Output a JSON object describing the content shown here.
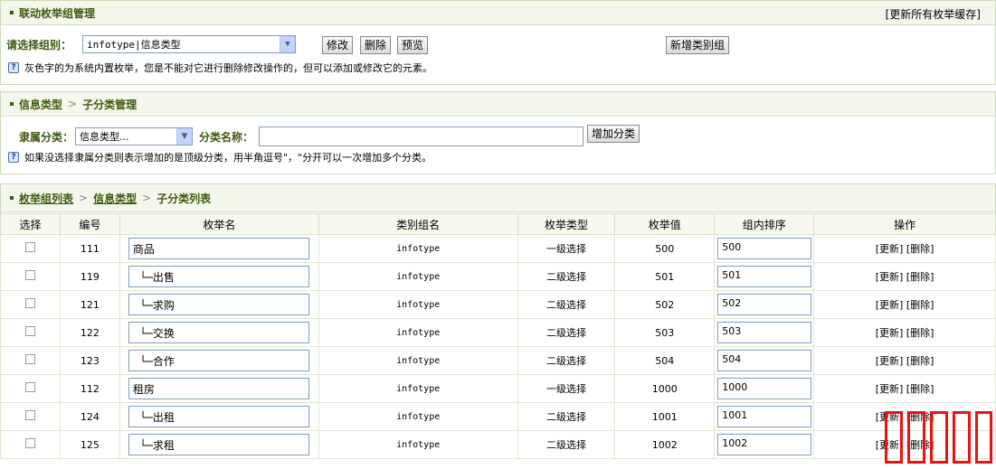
{
  "panel1": {
    "title": "联动枚举组管理",
    "refresh_link": "[更新所有枚举缓存]",
    "select_label": "请选择组别：",
    "select_value": "infotype|信息类型",
    "btn_edit": "修改",
    "btn_delete": "删除",
    "btn_preview": "预览",
    "btn_new_group": "新增类别组",
    "note": "灰色字的为系统内置枚举，您是不能对它进行删除修改操作的，但可以添加或修改它的元素。"
  },
  "panel2": {
    "crumb1": "信息类型",
    "crumb2": "子分类管理",
    "parent_label": "隶属分类：",
    "parent_value": "信息类型...",
    "name_label": "分类名称：",
    "btn_add": "增加分类",
    "note": "如果没选择隶属分类则表示增加的是顶级分类，用半角逗号\"，\"分开可以一次增加多个分类。"
  },
  "panel3": {
    "crumb1": "枚举组列表",
    "crumb2": "信息类型",
    "crumb3": "子分类列表"
  },
  "table": {
    "headers": [
      "选择",
      "编号",
      "枚举名",
      "类别组名",
      "枚举类型",
      "枚举值",
      "组内排序",
      "操作"
    ],
    "rows": [
      {
        "id": "111",
        "name": "商品",
        "group": "infotype",
        "type": "一级选择",
        "value": "500",
        "order": "500"
      },
      {
        "id": "119",
        "name": "  └─出售",
        "group": "infotype",
        "type": "二级选择",
        "value": "501",
        "order": "501"
      },
      {
        "id": "121",
        "name": "  └─求购",
        "group": "infotype",
        "type": "二级选择",
        "value": "502",
        "order": "502"
      },
      {
        "id": "122",
        "name": "  └─交换",
        "group": "infotype",
        "type": "二级选择",
        "value": "503",
        "order": "503"
      },
      {
        "id": "123",
        "name": "  └─合作",
        "group": "infotype",
        "type": "二级选择",
        "value": "504",
        "order": "504"
      },
      {
        "id": "112",
        "name": "租房",
        "group": "infotype",
        "type": "一级选择",
        "value": "1000",
        "order": "1000"
      },
      {
        "id": "124",
        "name": "  └─出租",
        "group": "infotype",
        "type": "二级选择",
        "value": "1001",
        "order": "1001"
      },
      {
        "id": "125",
        "name": "  └─求租",
        "group": "infotype",
        "type": "二级选择",
        "value": "1002",
        "order": "1002"
      }
    ],
    "op_update": "[更新]",
    "op_delete": "[删除]"
  },
  "colors": {
    "accent": "#3d5a0d",
    "overlay_red": "#ee1111"
  }
}
